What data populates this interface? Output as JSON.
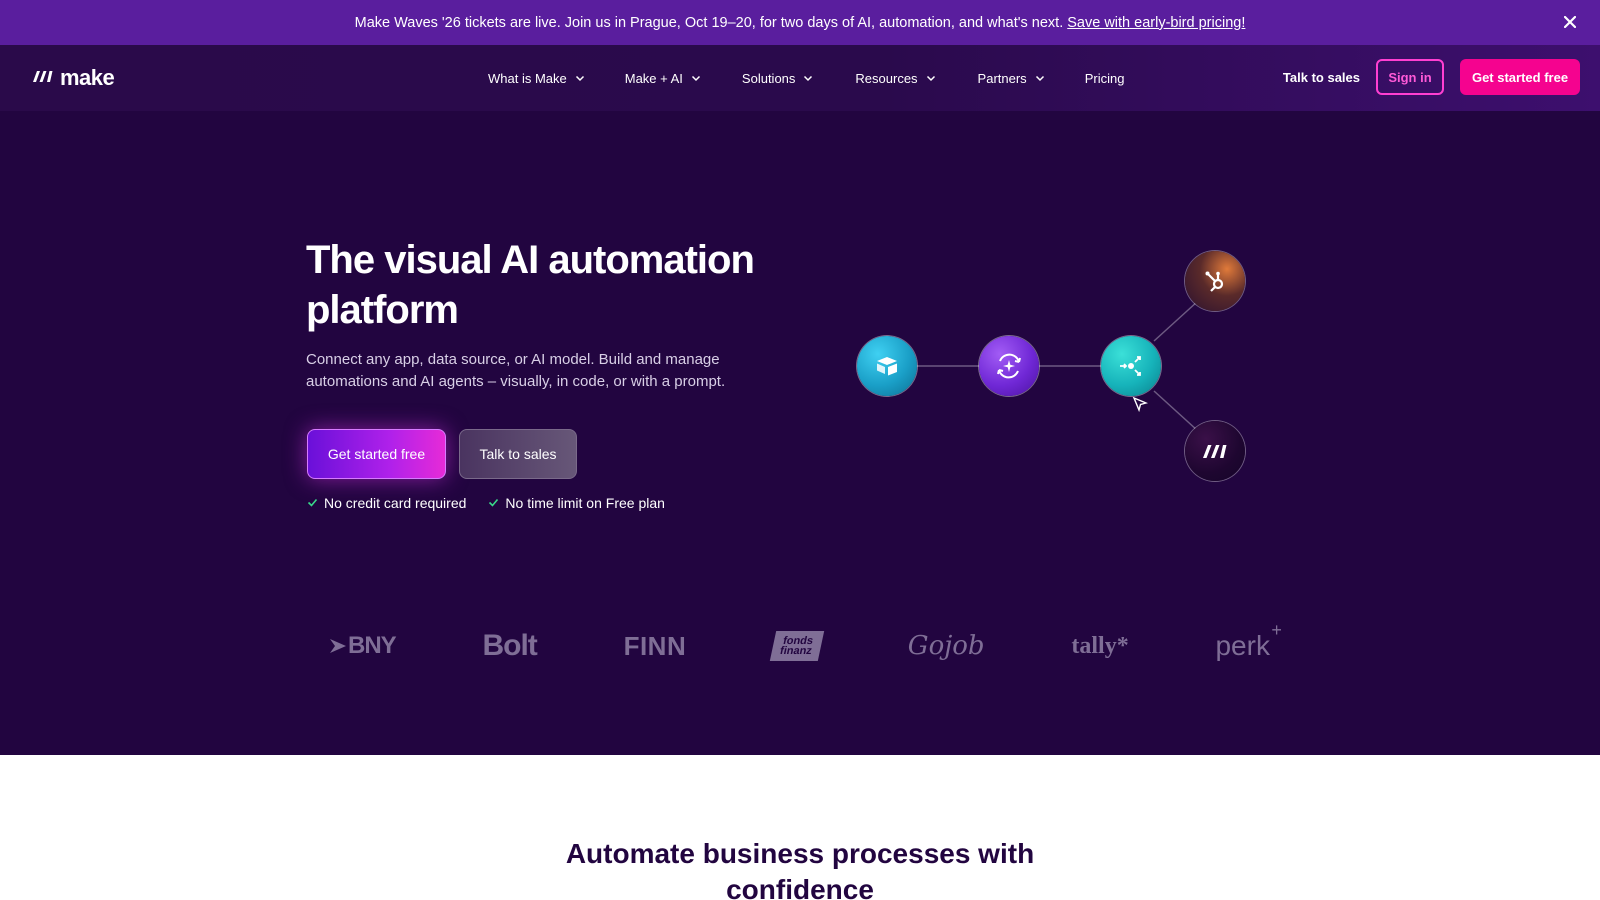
{
  "banner": {
    "text": "Make Waves '26 tickets are live. Join us in Prague, Oct 19–20, for two days of AI, automation, and what's next.",
    "link": "Save with early-bird pricing!",
    "close_icon": "close-icon"
  },
  "nav": {
    "logo_text": "make",
    "items": [
      {
        "label": "What is Make",
        "has_dropdown": true
      },
      {
        "label": "Make + AI",
        "has_dropdown": true
      },
      {
        "label": "Solutions",
        "has_dropdown": true
      },
      {
        "label": "Resources",
        "has_dropdown": true
      },
      {
        "label": "Partners",
        "has_dropdown": true
      },
      {
        "label": "Pricing",
        "has_dropdown": false
      }
    ],
    "talk_to_sales": "Talk to sales",
    "sign_in": "Sign in",
    "get_started": "Get started free"
  },
  "hero": {
    "title": "The visual AI automation platform",
    "subtitle": "Connect any app, data source, or AI model. Build and manage automations and AI agents – visually, in code, or with a prompt.",
    "primary_cta": "Get started free",
    "secondary_cta": "Talk to sales",
    "checks": [
      "No credit card required",
      "No time limit on Free plan"
    ]
  },
  "diagram": {
    "nodes": [
      "airtable-icon",
      "ai-agent-icon",
      "router-icon",
      "hubspot-icon",
      "make-icon"
    ]
  },
  "logos": [
    "BNY",
    "Bolt",
    "FINN",
    "fonds finanz",
    "Gojob",
    "tally*",
    "perk"
  ],
  "section": {
    "title": "Automate business processes with confidence"
  },
  "colors": {
    "banner_bg": "#5a1e9e",
    "hero_bg": "#220540",
    "accent_pink": "#f5038f",
    "accent_purple": "#8a1ee6"
  }
}
